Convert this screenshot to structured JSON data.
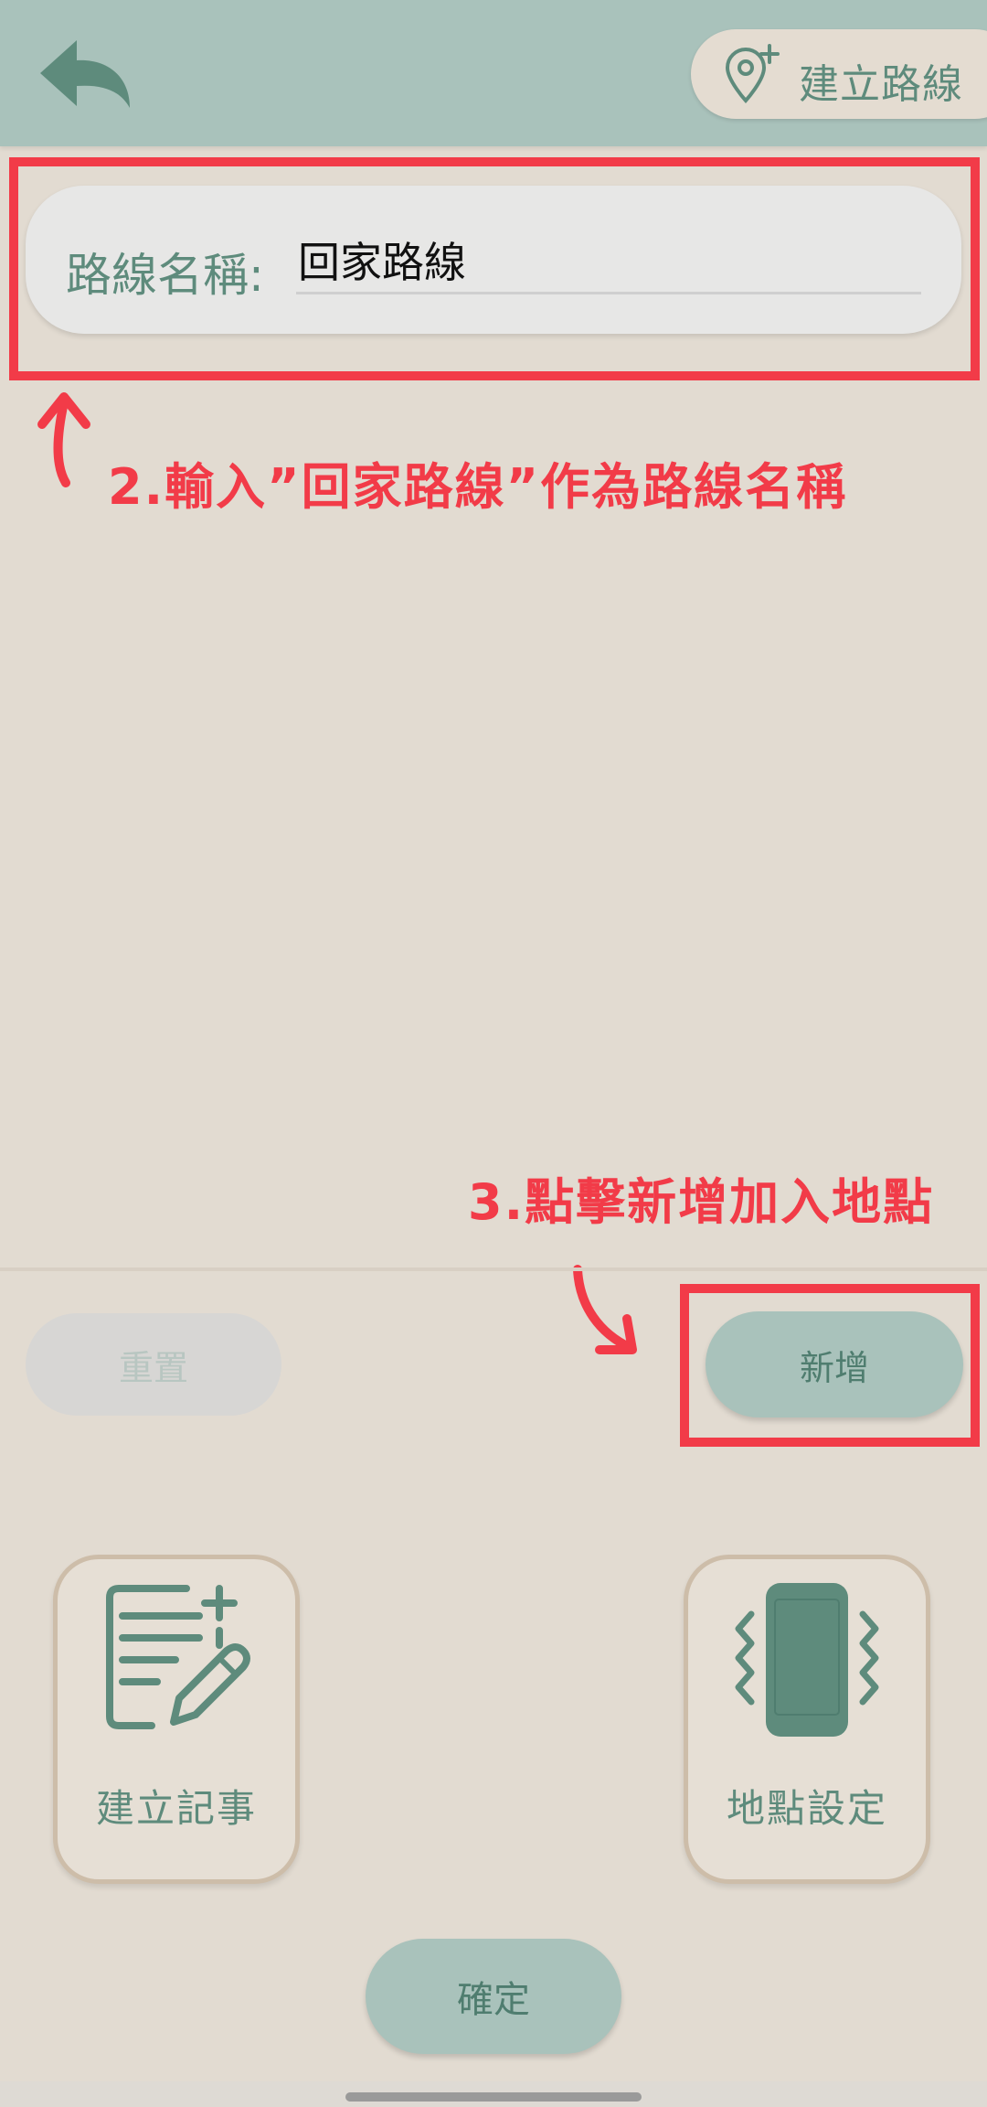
{
  "header": {
    "create_route_label": "建立路線"
  },
  "form": {
    "route_name_label": "路線名稱:",
    "route_name_value": "回家路線"
  },
  "actions": {
    "reset_label": "重置",
    "add_label": "新增",
    "confirm_label": "確定"
  },
  "tiles": {
    "create_note_label": "建立記事",
    "place_settings_label": "地點設定"
  },
  "annotations": {
    "step2": "2.輸入”回家路線”作為路線名稱",
    "step3": "3.點擊新增加入地點"
  },
  "colors": {
    "accent": "#5e8b7c",
    "header_bg": "#a9c2bb",
    "page_bg": "#e2dbd1",
    "annotation": "#f23b48"
  }
}
